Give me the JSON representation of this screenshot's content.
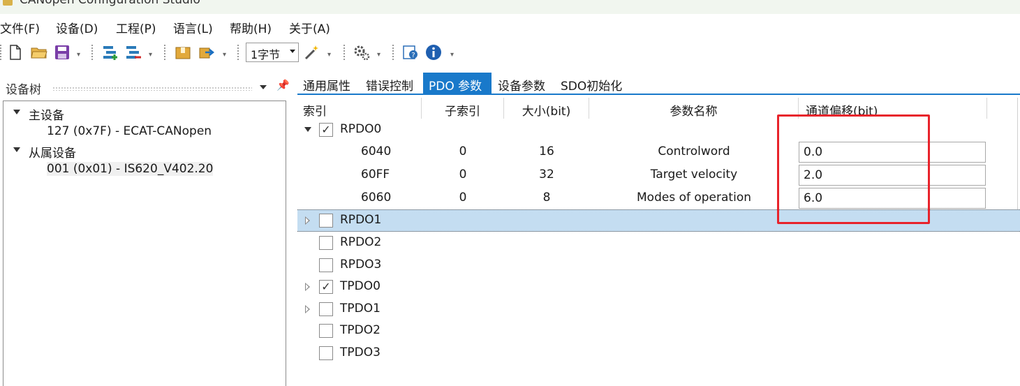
{
  "window": {
    "title": "CANopen Configuration Studio"
  },
  "menu": [
    {
      "label": "文件(F)"
    },
    {
      "label": "设备(D)"
    },
    {
      "label": "工程(P)"
    },
    {
      "label": "语言(L)"
    },
    {
      "label": "帮助(H)"
    },
    {
      "label": "关于(A)"
    }
  ],
  "toolbar": {
    "byte_select_value": "1字节",
    "icons": [
      "new-file-icon",
      "open-folder-icon",
      "save-icon",
      "add-node-icon",
      "remove-node-icon",
      "import-icon",
      "export-icon",
      "wand-icon",
      "settings-icon",
      "help-icon",
      "info-icon"
    ]
  },
  "left_panel": {
    "title": "设备树",
    "master_label": "主设备",
    "master_item": "127 (0x7F)  -  ECAT-CANopen",
    "slave_label": "从属设备",
    "slave_item": "001 (0x01)  -  IS620_V402.20"
  },
  "tabs": [
    {
      "label": "通用属性",
      "active": false
    },
    {
      "label": "错误控制",
      "active": false
    },
    {
      "label": "PDO 参数",
      "active": true
    },
    {
      "label": "设备参数",
      "active": false
    },
    {
      "label": "SDO初始化",
      "active": false
    }
  ],
  "grid": {
    "headers": {
      "index": "索引",
      "subindex": "子索引",
      "size": "大小(bit)",
      "name": "参数名称",
      "offset": "通道偏移(bit)"
    },
    "rpdo0": {
      "label": "RPDO0",
      "checked": true,
      "entries": [
        {
          "index": "6040",
          "subindex": "0",
          "size": "16",
          "name": "Controlword",
          "offset": "0.0"
        },
        {
          "index": "60FF",
          "subindex": "0",
          "size": "32",
          "name": "Target velocity",
          "offset": "2.0"
        },
        {
          "index": "6060",
          "subindex": "0",
          "size": "8",
          "name": "Modes of operation",
          "offset": "6.0"
        }
      ]
    },
    "pdos": [
      {
        "label": "RPDO1",
        "checked": false,
        "expandable": true,
        "selected": true
      },
      {
        "label": "RPDO2",
        "checked": false,
        "expandable": false
      },
      {
        "label": "RPDO3",
        "checked": false,
        "expandable": false
      },
      {
        "label": "TPDO0",
        "checked": true,
        "expandable": true
      },
      {
        "label": "TPDO1",
        "checked": false,
        "expandable": true
      },
      {
        "label": "TPDO2",
        "checked": false,
        "expandable": false
      },
      {
        "label": "TPDO3",
        "checked": false,
        "expandable": false
      }
    ]
  },
  "colors": {
    "accent": "#1979ca",
    "selected_row": "#c4ddf1",
    "highlight_box": "#e8232b"
  }
}
